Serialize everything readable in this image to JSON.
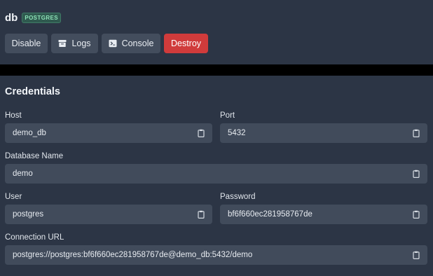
{
  "service": {
    "name": "db",
    "badge": "POSTGRES"
  },
  "actions": {
    "disable": "Disable",
    "logs": "Logs",
    "console": "Console",
    "destroy": "Destroy"
  },
  "credentials": {
    "title": "Credentials",
    "host": {
      "label": "Host",
      "value": "demo_db"
    },
    "port": {
      "label": "Port",
      "value": "5432"
    },
    "database": {
      "label": "Database Name",
      "value": "demo"
    },
    "user": {
      "label": "User",
      "value": "postgres"
    },
    "password": {
      "label": "Password",
      "value": "bf6f660ec281958767de"
    },
    "url": {
      "label": "Connection URL",
      "value": "postgres://postgres:bf6f660ec281958767de@demo_db:5432/demo"
    }
  },
  "icons": {
    "logs": "archive-box-icon",
    "console": "terminal-icon",
    "copy": "clipboard-icon"
  },
  "colors": {
    "background": "#2c3545",
    "button": "#434d5d",
    "danger": "#d03b3b",
    "field": "#414b5b",
    "badge_text": "#8ee2b8",
    "badge_bg": "#2f5a4f"
  }
}
